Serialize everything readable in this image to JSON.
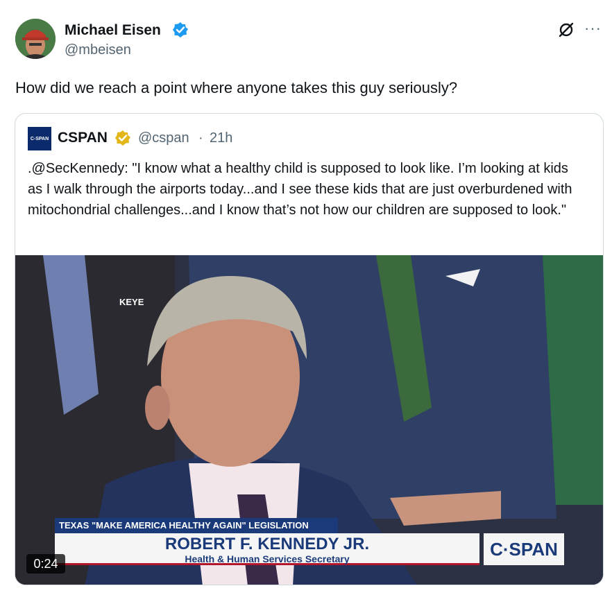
{
  "author": {
    "name": "Michael Eisen",
    "handle": "@mbeisen",
    "avatar_icon": "user-avatar-photo",
    "verified_icon": "verified-badge-icon",
    "verified_color": "#1d9bf0"
  },
  "tweet": {
    "text": "How did we reach a point where anyone takes this guy seriously?"
  },
  "header_actions": {
    "grok_icon": "grok-icon",
    "more_label": "···"
  },
  "quoted": {
    "avatar_label": "C-SPAN",
    "name": "CSPAN",
    "badge_color": "#e2b719",
    "handle": "@cspan",
    "separator": "·",
    "time": "21h",
    "text": ".@SecKennedy: \"I know what a healthy child is supposed to look like. I’m looking at kids as I walk through the airports today...and I see these kids that are just overburdened with mitochondrial challenges...and I know that’s not how our children are supposed to look.\"",
    "video": {
      "top_label": "KEYE",
      "banner_top": "TEXAS \"MAKE AMERICA HEALTHY AGAIN\" LEGISLATION",
      "banner_name": "ROBERT F. KENNEDY JR.",
      "banner_title": "Health & Human Services Secretary",
      "logo": "C·SPAN",
      "duration": "0:24"
    }
  }
}
